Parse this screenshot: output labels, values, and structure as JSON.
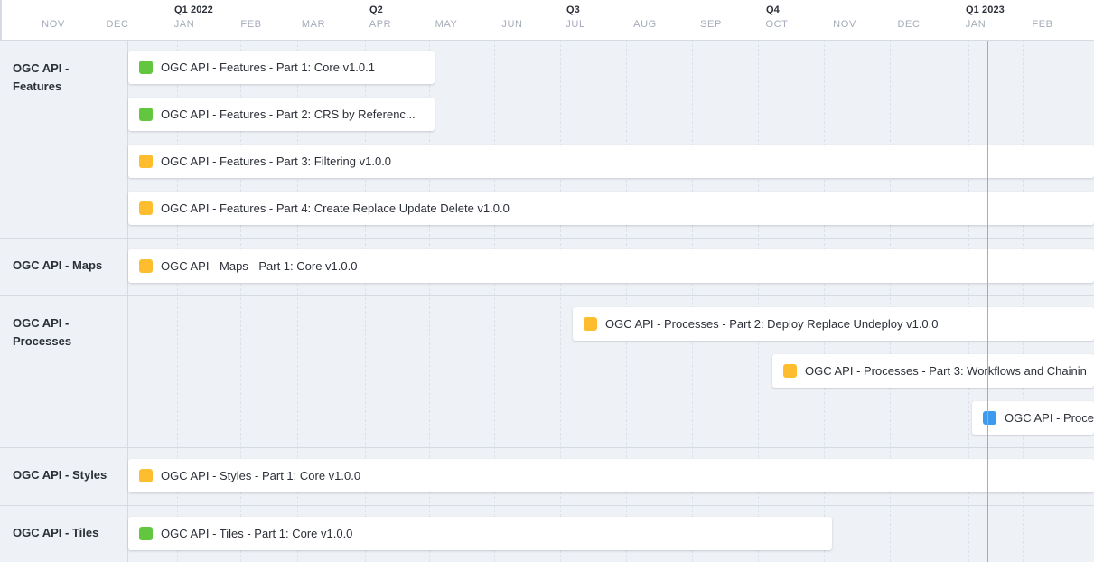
{
  "timeline": {
    "quarters": [
      {
        "id": "q1-2022",
        "label": "Q1 2022"
      },
      {
        "id": "q2",
        "label": "Q2"
      },
      {
        "id": "q3",
        "label": "Q3"
      },
      {
        "id": "q4",
        "label": "Q4"
      },
      {
        "id": "q1-2023",
        "label": "Q1 2023"
      }
    ],
    "months": [
      "NOV",
      "DEC",
      "JAN",
      "FEB",
      "MAR",
      "APR",
      "MAY",
      "JUN",
      "JUL",
      "AUG",
      "SEP",
      "OCT",
      "NOV",
      "DEC",
      "JAN",
      "FEB"
    ]
  },
  "groups": [
    {
      "id": "features",
      "label": "OGC API - Features"
    },
    {
      "id": "maps",
      "label": "OGC API - Maps"
    },
    {
      "id": "processes",
      "label": "OGC API - Processes"
    },
    {
      "id": "styles",
      "label": "OGC API - Styles"
    },
    {
      "id": "tiles",
      "label": "OGC API - Tiles"
    }
  ],
  "items": [
    {
      "id": "features-part1",
      "label": "OGC API - Features - Part 1: Core v1.0.1",
      "status": "green"
    },
    {
      "id": "features-part2",
      "label": "OGC API - Features - Part 2: CRS by Referenc...",
      "status": "green"
    },
    {
      "id": "features-part3",
      "label": "OGC API - Features - Part 3: Filtering v1.0.0",
      "status": "yellow"
    },
    {
      "id": "features-part4",
      "label": "OGC API - Features - Part 4: Create Replace Update Delete v1.0.0",
      "status": "yellow"
    },
    {
      "id": "maps-part1",
      "label": "OGC API - Maps - Part 1: Core v1.0.0",
      "status": "yellow"
    },
    {
      "id": "processes-part2",
      "label": "OGC API - Processes - Part 2: Deploy Replace Undeploy v1.0.0",
      "status": "yellow"
    },
    {
      "id": "processes-part3",
      "label": "OGC API - Processes - Part 3: Workflows and Chainin",
      "status": "yellow"
    },
    {
      "id": "processes-other",
      "label": "OGC API - Proce",
      "status": "blue"
    },
    {
      "id": "styles-part1",
      "label": "OGC API - Styles - Part 1: Core v1.0.0",
      "status": "yellow"
    },
    {
      "id": "tiles-part1",
      "label": "OGC API - Tiles - Part 1: Core v1.0.0",
      "status": "green"
    }
  ],
  "status_colors": {
    "green": "#62c63f",
    "yellow": "#fdbd2e",
    "blue": "#3d9bef"
  }
}
